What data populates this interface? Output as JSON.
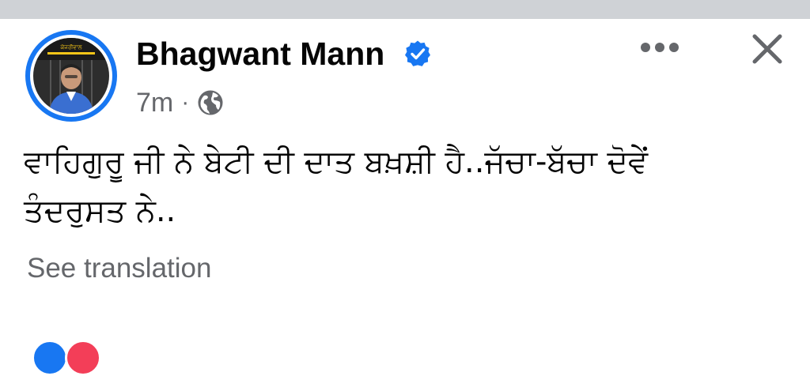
{
  "post": {
    "author": "Bhagwant Mann",
    "verified": true,
    "timestamp": "7m",
    "separator": "·",
    "audience_icon": "globe-icon",
    "avatar_banner": "ਕੇਜਰੀਵਾਲ",
    "text_lines": [
      "ਵਾਹਿਗੁਰੂ ਜੀ ਨੇ ਬੇਟੀ ਦੀ ਦਾਤ ਬਖ਼ਸ਼ੀ ਹੈ..ਜੱਚਾ-ਬੱਚਾ ਦੋਵੇਂ",
      "ਤੰਦਰੁਸਤ ਨੇ.."
    ],
    "see_translation": "See translation"
  },
  "actions": {
    "more_icon": "more-horizontal-icon",
    "close_icon": "close-icon"
  },
  "colors": {
    "brand_blue": "#1877f2",
    "text_primary": "#050505",
    "text_secondary": "#65676b",
    "top_strip": "#cfd2d6"
  }
}
